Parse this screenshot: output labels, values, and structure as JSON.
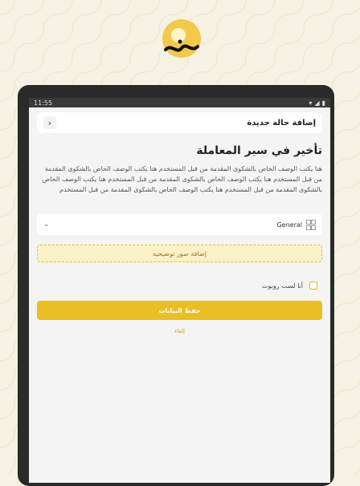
{
  "statusbar": {
    "time": "11:55",
    "wifi_icon": "wifi-icon",
    "signal_icon": "signal-icon",
    "battery_icon": "battery-icon"
  },
  "header": {
    "title": "إضافة حالة جديدة",
    "back_icon": "chevron-left-icon"
  },
  "case": {
    "title": "تأخير في سير المعاملة",
    "description": "هنا يكتب الوصف الخاص بالشكوى المقدمة من قبل المستخدم هنا يكتب الوصف الخاص بالشكوى المقدمة من قبل المستخدم هنا يكتب الوصف الخاص بالشكوى المقدمة من قبل المستخدم هنا يكتب الوصف الخاص بالشكوى المقدمة من قبل المستخدم هنا يكتب الوصف الخاص بالشكوى المقدمة من قبل المستخدم"
  },
  "category_select": {
    "value": "General"
  },
  "upload": {
    "label": "إضافة صور توضيحية"
  },
  "captcha": {
    "label": "أنا لست روبوت"
  },
  "actions": {
    "save_label": "حفظ البيانات",
    "link_label": "إلغاء"
  },
  "colors": {
    "accent": "#e9bf24",
    "background": "#f6f2e3"
  }
}
